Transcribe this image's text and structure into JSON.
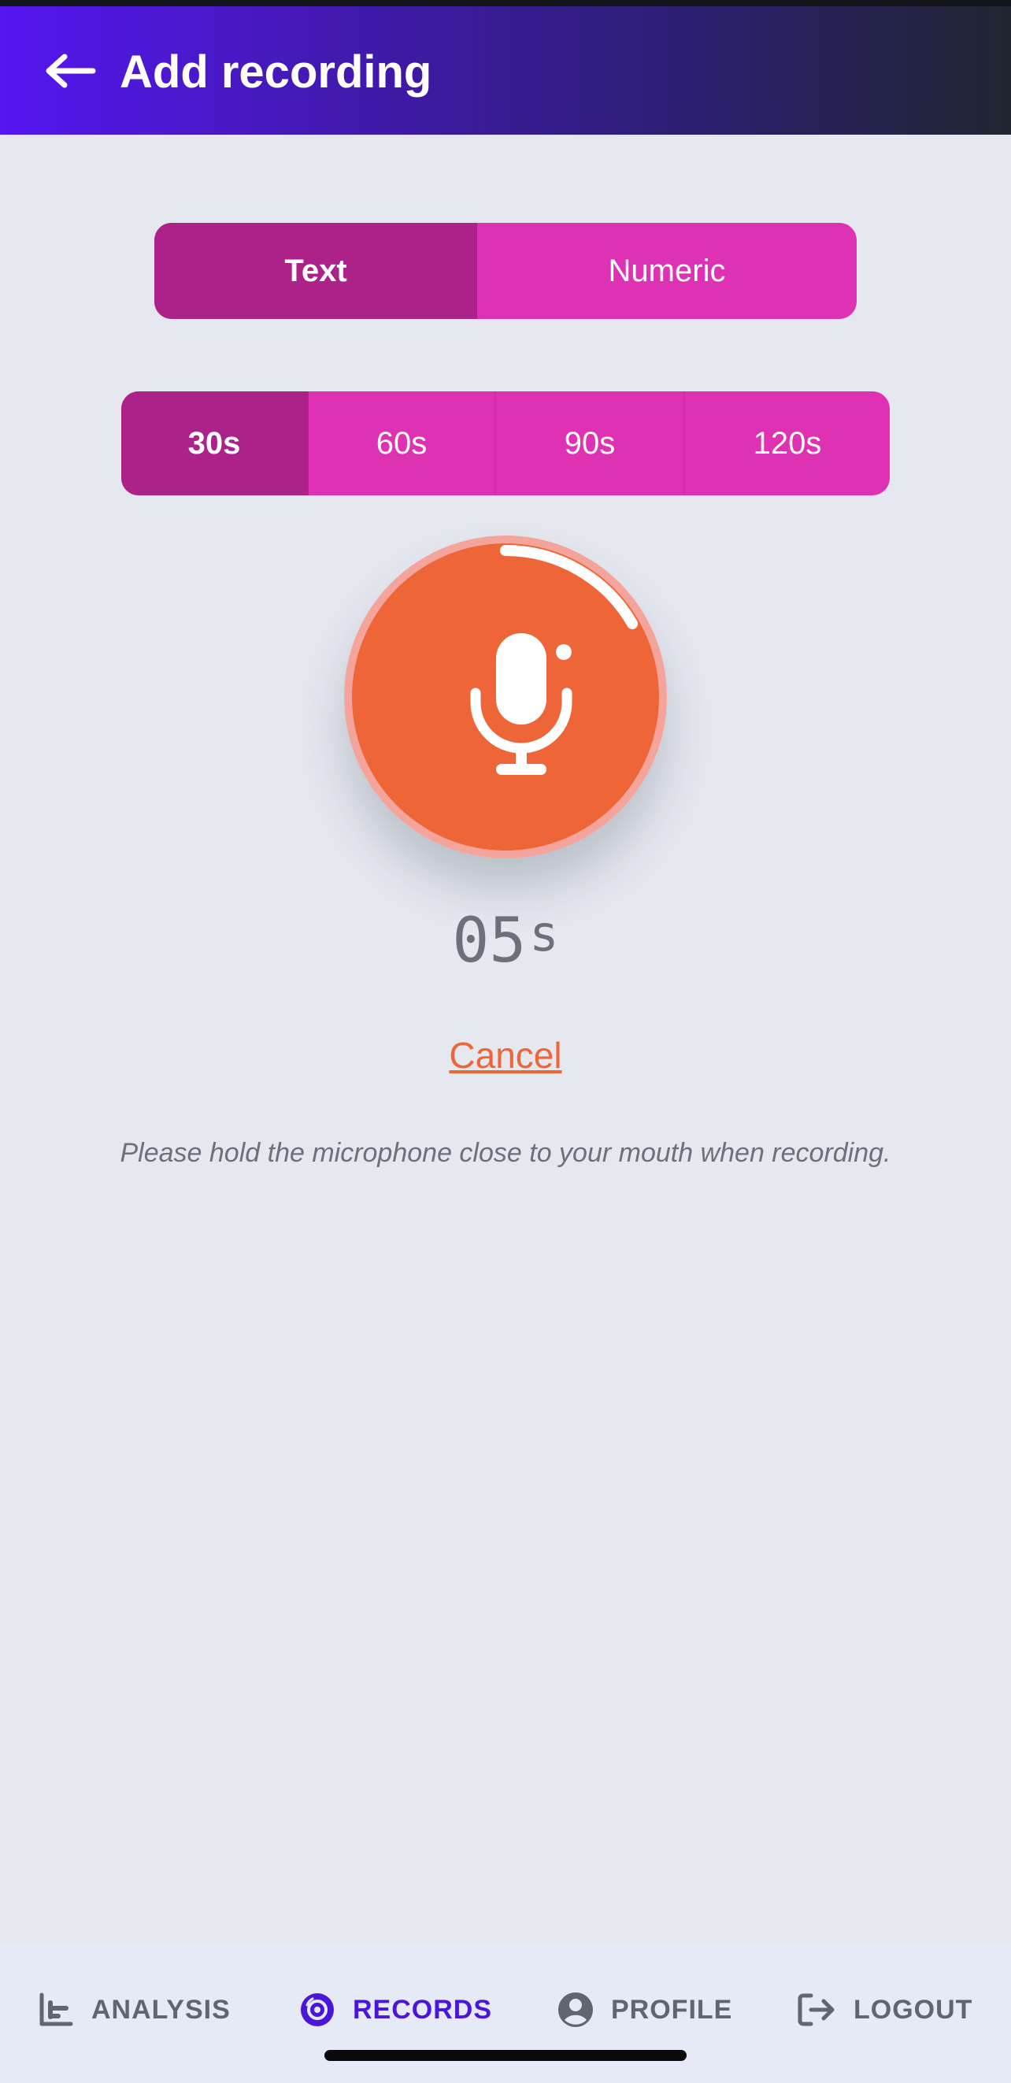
{
  "header": {
    "title": "Add recording",
    "back_icon": "arrow-left-icon"
  },
  "type_selector": {
    "options": [
      {
        "label": "Text",
        "selected": true
      },
      {
        "label": "Numeric",
        "selected": false
      }
    ]
  },
  "duration_selector": {
    "options": [
      {
        "label": "30s",
        "selected": true
      },
      {
        "label": "60s",
        "selected": false
      },
      {
        "label": "90s",
        "selected": false
      },
      {
        "label": "120s",
        "selected": false
      }
    ]
  },
  "recorder": {
    "icon": "microphone-icon",
    "progress_fraction": 0.1667,
    "timer_value": "05",
    "timer_unit": "s",
    "cancel_label": "Cancel",
    "hint": "Please hold the microphone close to your mouth when recording."
  },
  "bottom_nav": {
    "items": [
      {
        "label": "ANALYSIS",
        "icon": "bar-chart-icon",
        "active": false
      },
      {
        "label": "RECORDS",
        "icon": "record-disc-icon",
        "active": true
      },
      {
        "label": "PROFILE",
        "icon": "user-circle-icon",
        "active": false
      },
      {
        "label": "LOGOUT",
        "icon": "logout-icon",
        "active": false
      }
    ]
  },
  "colors": {
    "header_start": "#5516f0",
    "header_end": "#1f2630",
    "segment_selected": "#ad2289",
    "segment_default": "#df31b4",
    "record_button": "#ee6638",
    "record_ring": "#f4a49a",
    "nav_active": "#4a17d9",
    "nav_inactive": "#5f6670"
  }
}
